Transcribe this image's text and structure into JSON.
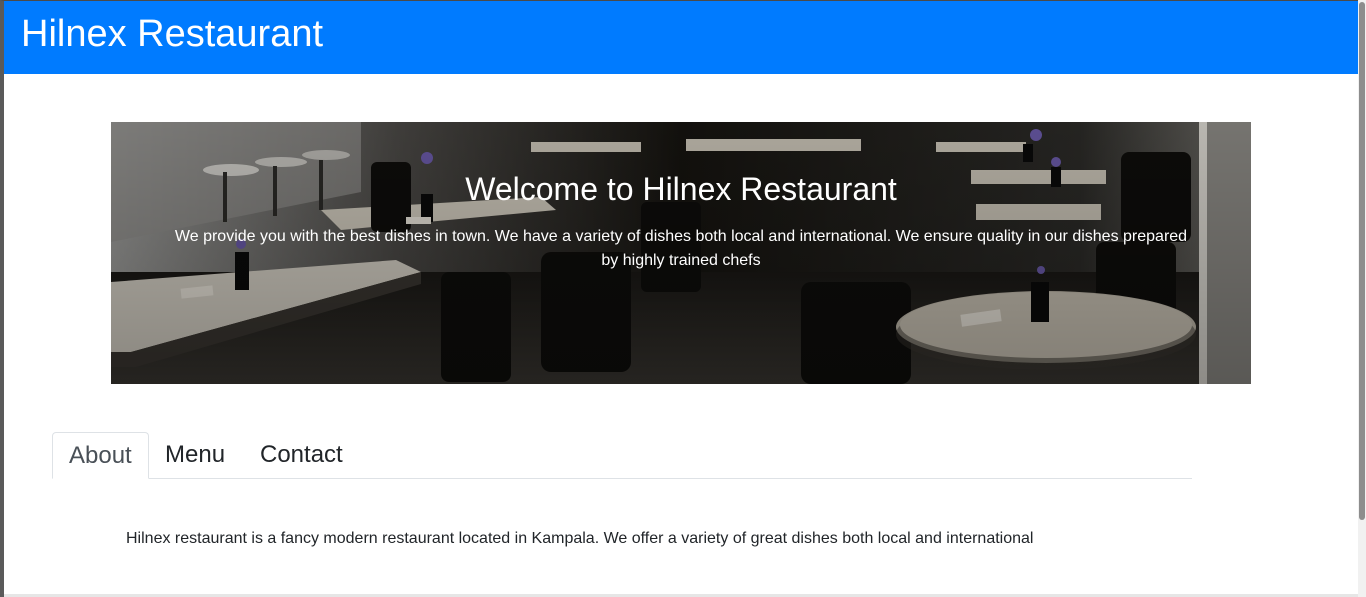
{
  "app": {
    "brand": "Hilnex Restaurant"
  },
  "hero": {
    "title": "Welcome to Hilnex Restaurant",
    "text": "We provide you with the best dishes in town. We have a variety of dishes both local and international. We ensure quality in our dishes prepared by highly trained chefs",
    "image": "restaurant-interior-photo"
  },
  "tabs": [
    {
      "label": "About",
      "active": true
    },
    {
      "label": "Menu",
      "active": false
    },
    {
      "label": "Contact",
      "active": false
    }
  ],
  "about": {
    "text": "Hilnex restaurant is a fancy modern restaurant located in Kampala. We offer a variety of great dishes both local and international"
  },
  "colors": {
    "navbar": "#007bff",
    "text": "#212529"
  }
}
